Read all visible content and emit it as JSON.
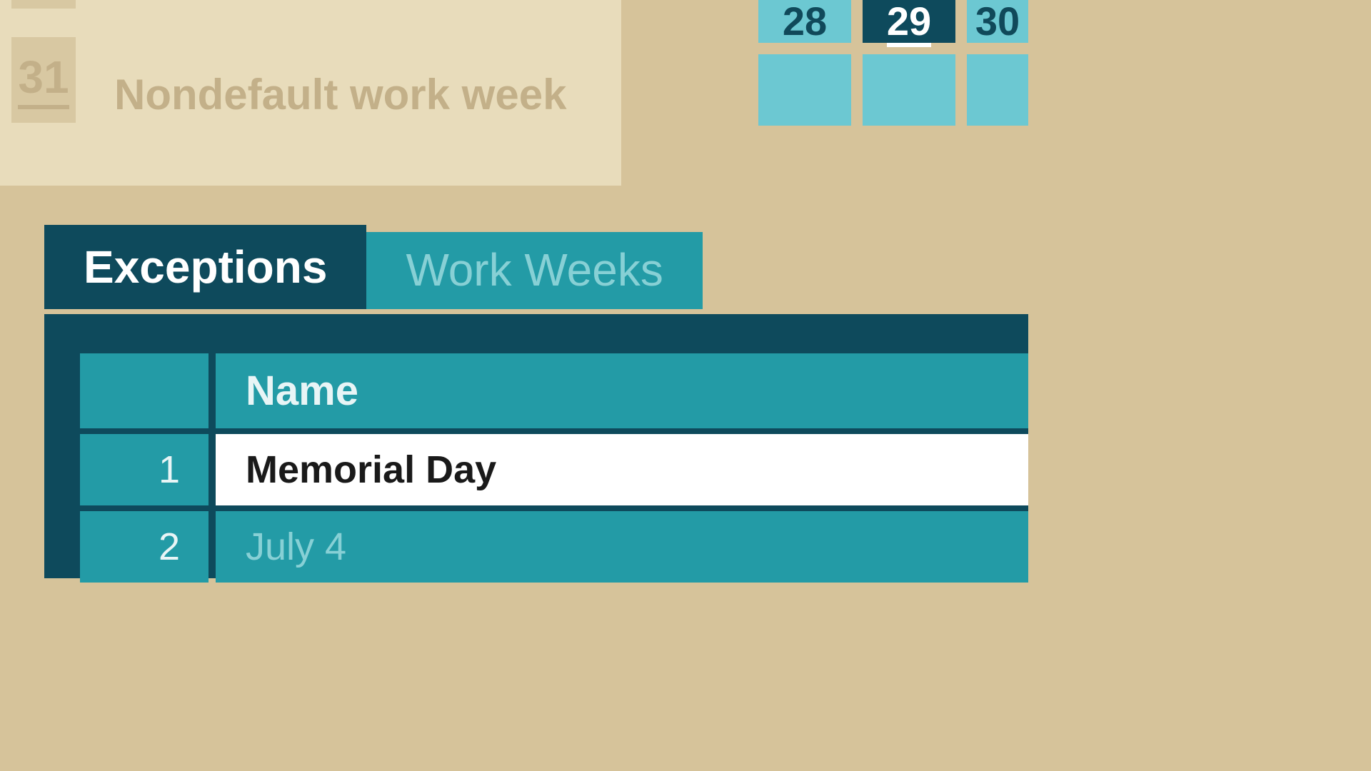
{
  "faded": {
    "day": "31",
    "title": "Nondefault work week"
  },
  "calendar": {
    "row1": [
      "28",
      "29",
      "30"
    ],
    "selected_index": 1
  },
  "tabs": {
    "active": "Exceptions",
    "inactive": "Work Weeks"
  },
  "table": {
    "header": "Name",
    "rows": [
      {
        "num": "1",
        "name": "Memorial Day",
        "selected": true
      },
      {
        "num": "2",
        "name": "July 4",
        "selected": false
      }
    ]
  }
}
